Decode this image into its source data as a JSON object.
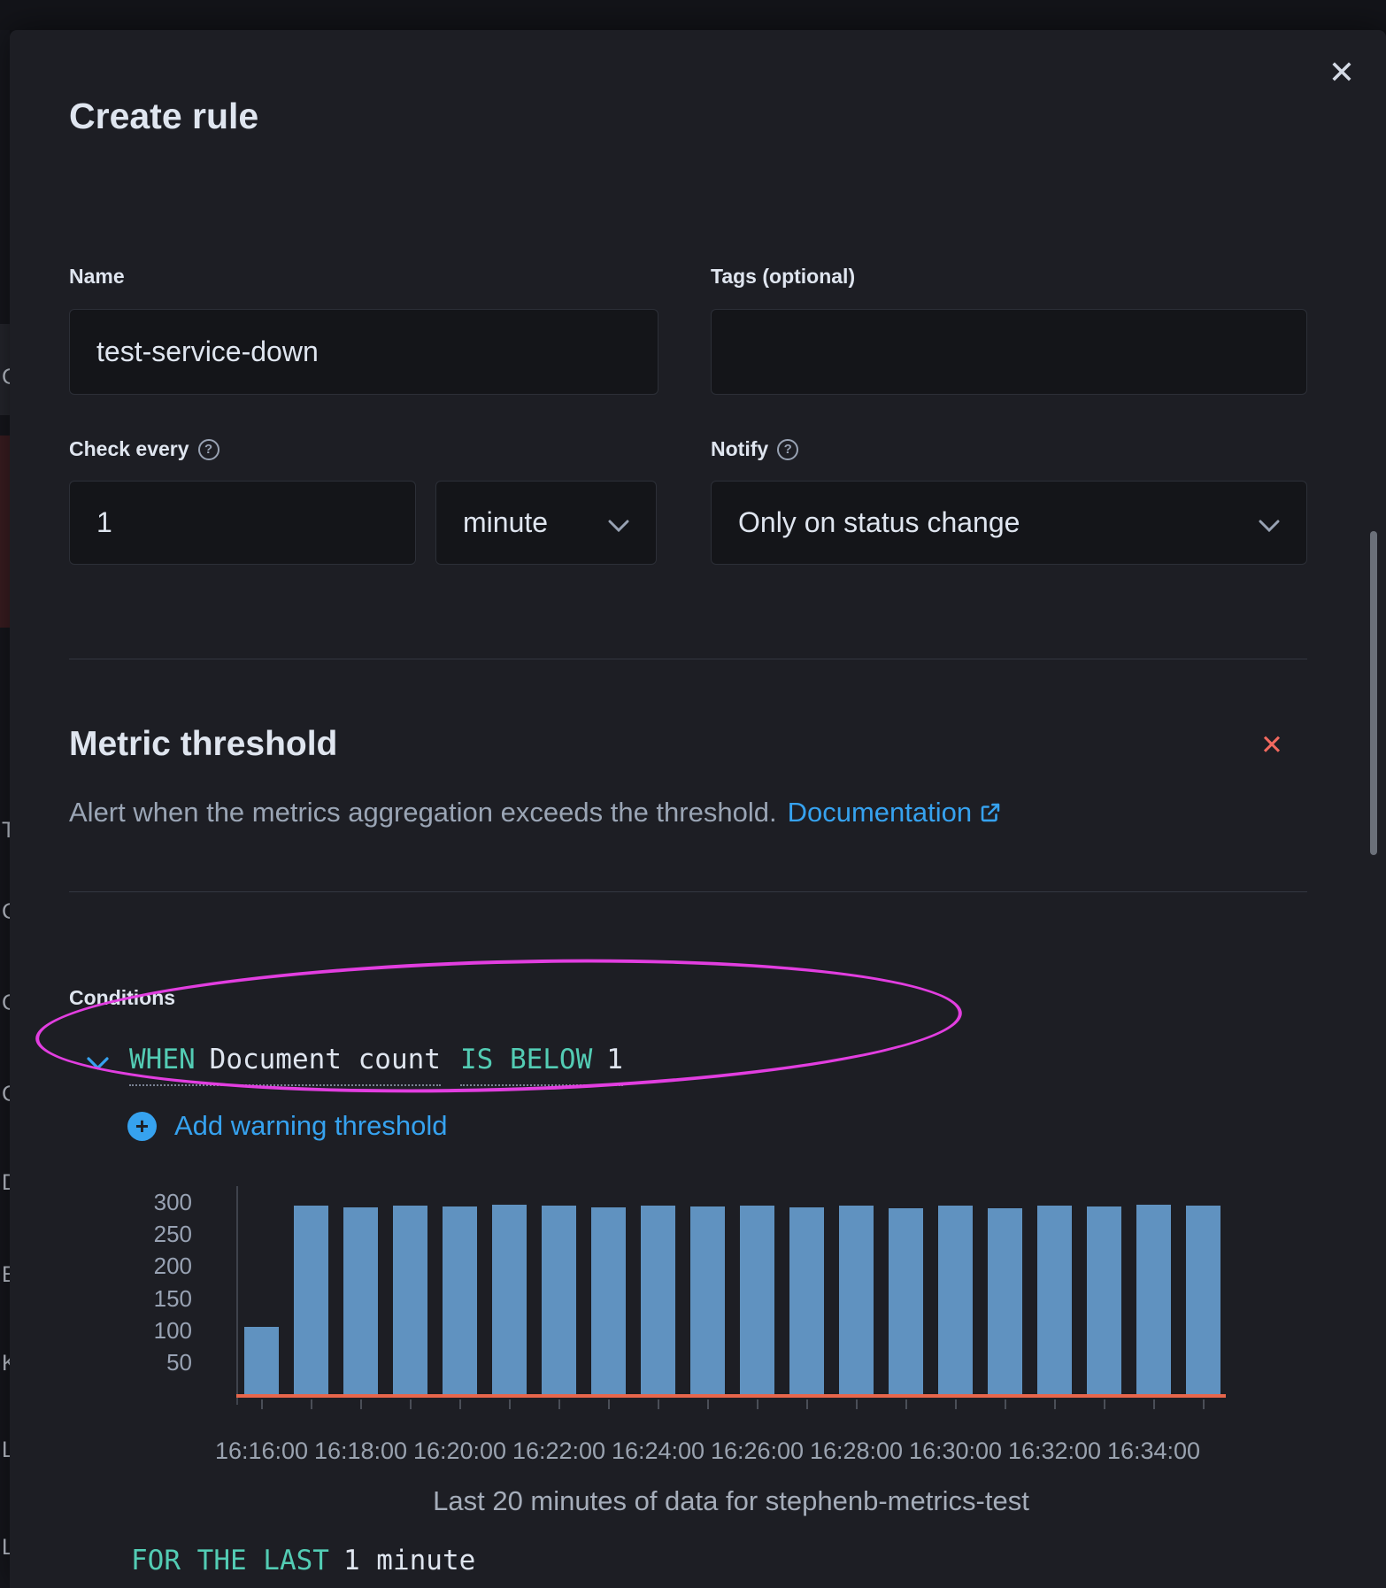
{
  "page": {
    "left_strip_fragments": [
      "C",
      "Ty",
      "C",
      "C",
      "C",
      "D",
      "El",
      "Ki",
      "Li",
      "Lo"
    ]
  },
  "modal": {
    "title": "Create rule",
    "close_icon": "✕"
  },
  "form": {
    "name_label": "Name",
    "name_value": "test-service-down",
    "tags_label": "Tags (optional)",
    "tags_value": "",
    "check_every_label": "Check every",
    "check_every_value": "1",
    "check_every_unit": "minute",
    "notify_label": "Notify",
    "notify_value": "Only on status change",
    "help_glyph": "?"
  },
  "rule_type": {
    "title": "Metric threshold",
    "description": "Alert when the metrics aggregation exceeds the threshold.",
    "doc_link_label": "Documentation",
    "remove_icon": "✕"
  },
  "conditions": {
    "heading": "Conditions",
    "when_label": "WHEN",
    "when_value": "Document count",
    "operator_label": "IS BELOW",
    "operator_value": "1",
    "add_warning_label": "Add warning threshold",
    "plus_glyph": "+",
    "for_last_label": "FOR THE LAST",
    "for_last_value": "1 minute"
  },
  "chart_data": {
    "type": "bar",
    "title": "Last 20 minutes of data for stephenb-metrics-test",
    "values": [
      105,
      295,
      292,
      295,
      293,
      296,
      294,
      292,
      295,
      293,
      295,
      292,
      295,
      291,
      294,
      291,
      295,
      293,
      296,
      294
    ],
    "x_tick_labels": [
      "16:16:00",
      "16:18:00",
      "16:20:00",
      "16:22:00",
      "16:24:00",
      "16:26:00",
      "16:28:00",
      "16:30:00",
      "16:32:00",
      "16:34:00"
    ],
    "y_tick_labels": [
      300,
      250,
      200,
      150,
      100,
      50
    ],
    "ylim": [
      0,
      325
    ],
    "threshold": 1,
    "bar_color": "#6092C0",
    "threshold_color": "#E7664C",
    "legend": "off",
    "grid": "off"
  },
  "colors": {
    "accent_blue": "#36A2EF",
    "teal": "#53CCB4",
    "magenta": "#E23EE0",
    "danger_red": "#F2695F",
    "bar_blue": "#6092C0",
    "threshold_red": "#E7664C"
  }
}
